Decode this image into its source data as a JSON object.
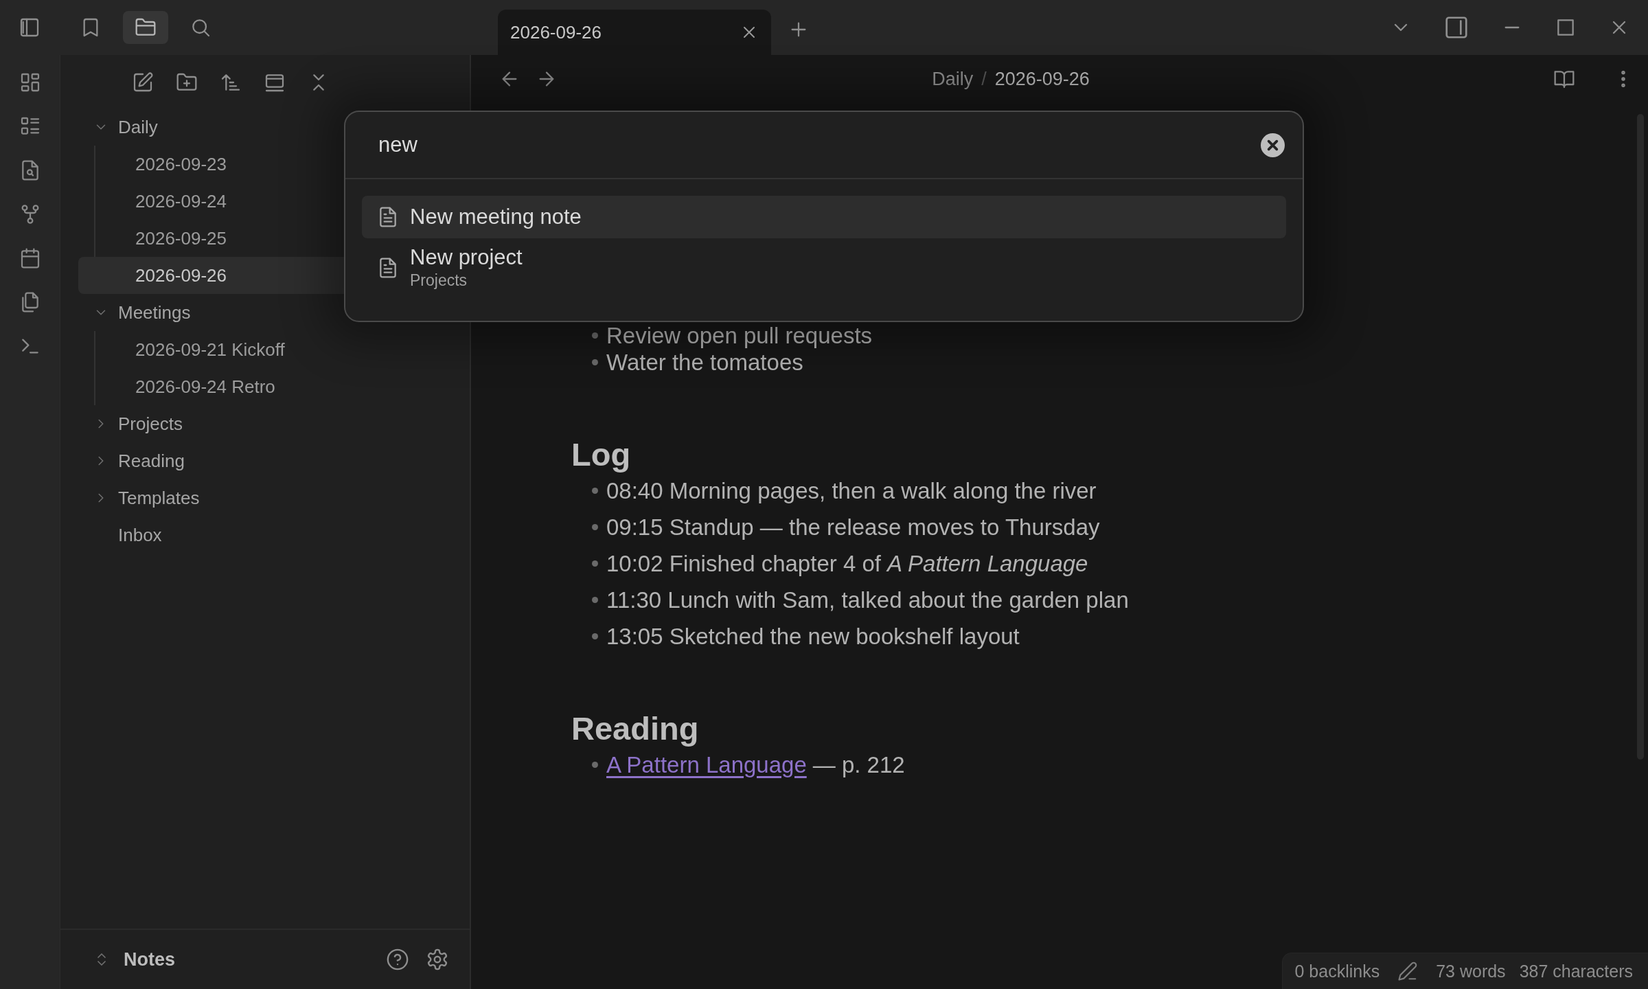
{
  "sidebar_tabs": [
    {
      "kind": "bookmark",
      "selected": false
    },
    {
      "kind": "folder",
      "selected": true
    },
    {
      "kind": "search",
      "selected": false
    }
  ],
  "tabs": [
    {
      "label": "2026-09-26",
      "selected": true
    }
  ],
  "breadcrumb": {
    "parts": [
      "Daily",
      "2026-09-26"
    ],
    "separator": "/"
  },
  "tree": [
    {
      "label": "Daily",
      "kind": "folder",
      "expanded": true,
      "children": [
        {
          "label": "2026-09-23",
          "kind": "file",
          "selected": false
        },
        {
          "label": "2026-09-24",
          "kind": "file",
          "selected": false
        },
        {
          "label": "2026-09-25",
          "kind": "file",
          "selected": false
        },
        {
          "label": "2026-09-26",
          "kind": "file",
          "selected": true
        }
      ]
    },
    {
      "label": "Meetings",
      "kind": "folder",
      "expanded": true,
      "children": [
        {
          "label": "2026-09-21 Kickoff",
          "kind": "file",
          "selected": false
        },
        {
          "label": "2026-09-24 Retro",
          "kind": "file",
          "selected": false
        }
      ]
    },
    {
      "label": "Projects",
      "kind": "folder",
      "expanded": false
    },
    {
      "label": "Reading",
      "kind": "folder",
      "expanded": false
    },
    {
      "label": "Templates",
      "kind": "folder",
      "expanded": false
    },
    {
      "label": "Inbox",
      "kind": "file",
      "selected": false
    }
  ],
  "vault": {
    "name": "Notes"
  },
  "note": {
    "sections": [
      {
        "bullets": [
          {
            "kind": "text",
            "text": "Review open pull requests"
          },
          {
            "kind": "text",
            "text": "Water the tomatoes"
          }
        ]
      },
      {
        "heading": "Log",
        "bullets": [
          {
            "kind": "text",
            "text": "08:40 Morning pages, then a walk along the river"
          },
          {
            "kind": "text",
            "text": "09:15 Standup — the release moves to Thursday"
          },
          {
            "kind": "text",
            "text": "10:02 Finished chapter 4 of *A Pattern Language*"
          },
          {
            "kind": "text",
            "text": "11:30 Lunch with Sam, talked about the garden plan"
          },
          {
            "kind": "text",
            "text": "13:05 Sketched the new bookshelf layout"
          }
        ]
      },
      {
        "heading": "Reading",
        "bullets": [
          {
            "kind": "link",
            "link": "A Pattern Language",
            "text": "— p. 212"
          }
        ]
      }
    ]
  },
  "search": {
    "value": "new",
    "results": [
      {
        "title": "New meeting note",
        "selected": true
      },
      {
        "title": "New project",
        "path": "Projects",
        "selected": false
      }
    ]
  },
  "status_bar": {
    "backlinks": "0 backlinks",
    "words": "73 words",
    "characters": "387 characters"
  }
}
